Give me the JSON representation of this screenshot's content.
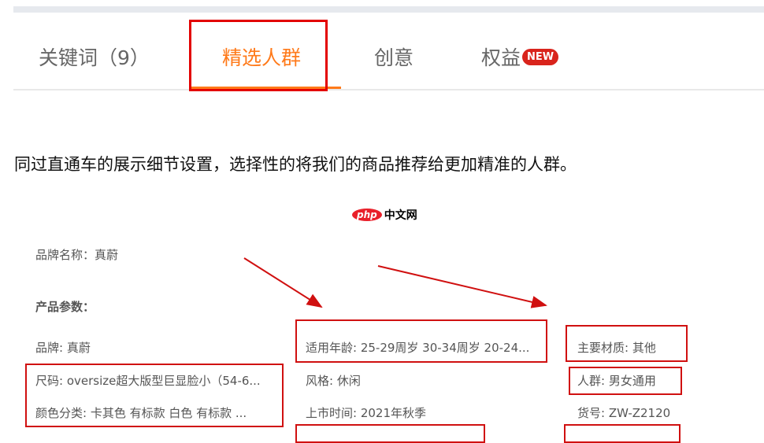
{
  "tabs": [
    {
      "label": "关键词（9）"
    },
    {
      "label": "精选人群"
    },
    {
      "label": "创意"
    },
    {
      "label": "权益",
      "badge": "NEW"
    }
  ],
  "description": "同过直通车的展示细节设置，选择性的将我们的商品推荐给更加精准的人群。",
  "logo": {
    "php": "php",
    "text": "中文网"
  },
  "brand_name": "品牌名称：真蔚",
  "params_title": "产品参数：",
  "params": [
    [
      "品牌: 真蔚",
      "适用年龄: 25-29周岁 30-34周岁 20-24...",
      "主要材质: 其他"
    ],
    [
      "尺码: oversize超大版型巨显脸小（54-6...",
      "风格: 休闲",
      "人群: 男女通用"
    ],
    [
      "颜色分类: 卡其色 有标款 白色 有标款 ...",
      "上市时间: 2021年秋季",
      "货号: ZW-Z2120"
    ]
  ],
  "colors": {
    "accent": "#ff7a1a",
    "highlight": "#e30000"
  }
}
